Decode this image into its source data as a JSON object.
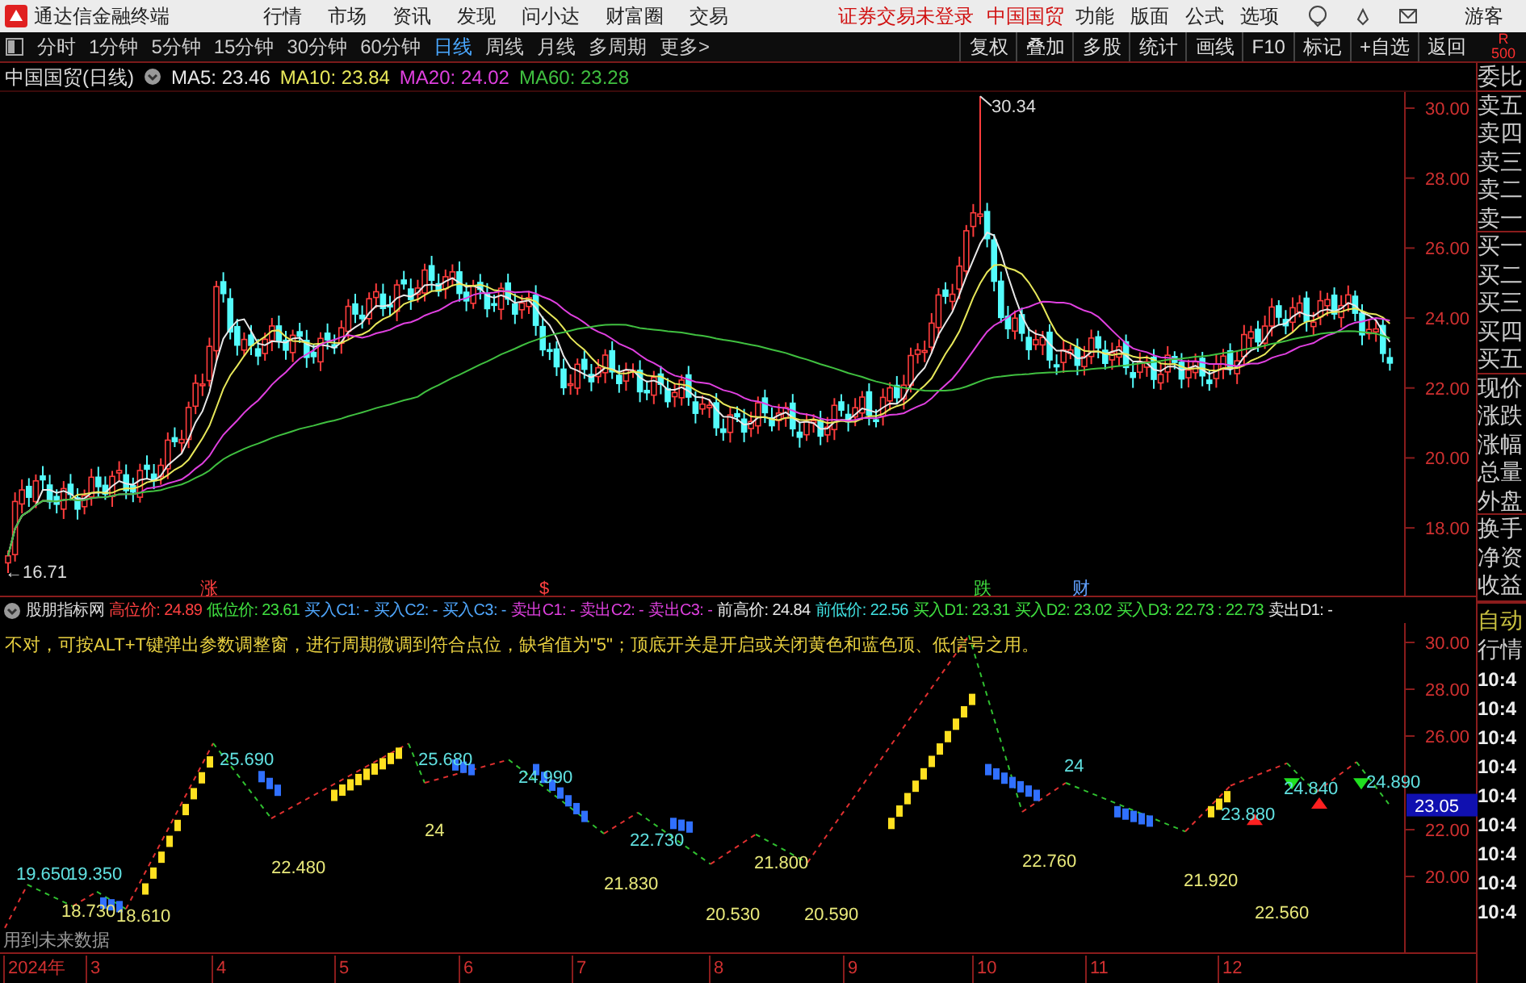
{
  "app": {
    "title": "通达信金融终端",
    "menu": [
      "行情",
      "市场",
      "资讯",
      "发现",
      "问小达",
      "财富圈",
      "交易"
    ],
    "notice": "证券交易未登录",
    "stock": "中国国贸",
    "right_menu": [
      "功能",
      "版面",
      "公式",
      "选项"
    ],
    "user": "游客"
  },
  "periods": [
    {
      "label": "分时",
      "selected": false
    },
    {
      "label": "1分钟",
      "selected": false
    },
    {
      "label": "5分钟",
      "selected": false
    },
    {
      "label": "15分钟",
      "selected": false
    },
    {
      "label": "30分钟",
      "selected": false
    },
    {
      "label": "60分钟",
      "selected": false
    },
    {
      "label": "日线",
      "selected": true
    },
    {
      "label": "周线",
      "selected": false
    },
    {
      "label": "月线",
      "selected": false
    },
    {
      "label": "多周期",
      "selected": false
    },
    {
      "label": "更多>",
      "selected": false
    }
  ],
  "tools": [
    "复权",
    "叠加",
    "多股",
    "统计",
    "画线",
    "F10",
    "标记",
    "+自选",
    "返回"
  ],
  "corner": [
    "R",
    "500"
  ],
  "main_chart": {
    "title": "中国国贸(日线)",
    "legend": [
      {
        "text": "MA5: 23.46",
        "color": "#e8e8e8"
      },
      {
        "text": "MA10: 23.84",
        "color": "#e8e85a"
      },
      {
        "text": "MA20: 24.02",
        "color": "#e040e0"
      },
      {
        "text": "MA60: 23.28",
        "color": "#40c040"
      }
    ],
    "high_label": "30.34",
    "low_label": "←16.71",
    "markers": [
      {
        "text": "涨",
        "color": "#ff4040"
      },
      {
        "text": "$",
        "color": "#ff4040"
      },
      {
        "text": "跌",
        "color": "#40e040"
      },
      {
        "text": "财",
        "color": "#60a0ff"
      }
    ],
    "price_axis": [
      "30.00",
      "28.00",
      "26.00",
      "24.00",
      "22.00",
      "20.00",
      "18.00"
    ]
  },
  "indicator": {
    "name": "股朋指标网",
    "legend": [
      {
        "text": "高位价: 24.89",
        "color": "#ff4040"
      },
      {
        "text": "低位价: 23.61",
        "color": "#40e040"
      },
      {
        "text": "买入C1: -",
        "color": "#50a8ff"
      },
      {
        "text": "买入C2: -",
        "color": "#50a8ff"
      },
      {
        "text": "买入C3: -",
        "color": "#50a8ff"
      },
      {
        "text": "卖出C1: -",
        "color": "#e040e0"
      },
      {
        "text": "卖出C2: -",
        "color": "#e040e0"
      },
      {
        "text": "卖出C3: -",
        "color": "#e040e0"
      },
      {
        "text": "前高价: 24.84",
        "color": "#e8e8e8"
      },
      {
        "text": "前低价: 22.56",
        "color": "#40e0e0"
      },
      {
        "text": "买入D1: 23.31",
        "color": "#40e040"
      },
      {
        "text": "买入D2: 23.02",
        "color": "#40e040"
      },
      {
        "text": "买入D3: 22.73 : 22.73",
        "color": "#40e040"
      },
      {
        "text": "卖出D1: -",
        "color": "#e8e8e8"
      }
    ],
    "info": "不对，可按ALT+T键弹出参数调整窗，进行周期微调到符合点位，缺省值为\"5\"；顶底开关是开启或关闭黄色和蓝色顶、低信号之用。",
    "labels": [
      {
        "text": "19.650",
        "kind": "high"
      },
      {
        "text": "18.730",
        "kind": "low"
      },
      {
        "text": "19.350",
        "kind": "high"
      },
      {
        "text": "18.610",
        "kind": "low"
      },
      {
        "text": "25.690",
        "kind": "high"
      },
      {
        "text": "22.480",
        "kind": "low"
      },
      {
        "text": "25.680",
        "kind": "high"
      },
      {
        "text": "24",
        "kind": "low"
      },
      {
        "text": "24.990",
        "kind": "high"
      },
      {
        "text": "21.830",
        "kind": "low"
      },
      {
        "text": "22.730",
        "kind": "high"
      },
      {
        "text": "20.530",
        "kind": "low"
      },
      {
        "text": "21.800",
        "kind": "low"
      },
      {
        "text": "20.590",
        "kind": "low"
      },
      {
        "text": "22.760",
        "kind": "low"
      },
      {
        "text": "24",
        "kind": "high"
      },
      {
        "text": "21.920",
        "kind": "low"
      },
      {
        "text": "23.880",
        "kind": "high"
      },
      {
        "text": "22.560",
        "kind": "low"
      },
      {
        "text": "24.840",
        "kind": "high"
      },
      {
        "text": "24.890",
        "kind": "high"
      }
    ],
    "note": "用到未来数据",
    "price_axis": [
      "30.00",
      "28.00",
      "26.00",
      "22.00",
      "20.00"
    ],
    "current_price": "23.05"
  },
  "x_axis": [
    "2024年",
    "3",
    "4",
    "5",
    "6",
    "7",
    "8",
    "9",
    "10",
    "11",
    "12"
  ],
  "side_panel": {
    "fields": [
      "委比",
      "卖五",
      "卖四",
      "卖三",
      "卖二",
      "卖一",
      "买一",
      "买二",
      "买三",
      "买四",
      "买五",
      "现价",
      "涨跌",
      "涨幅",
      "总量",
      "外盘",
      "换手",
      "净资",
      "收益"
    ],
    "mode": [
      "自动",
      "行情"
    ],
    "times": [
      "10:4",
      "10:4",
      "10:4",
      "10:4",
      "10:4",
      "10:4",
      "10:4",
      "10:4",
      "10:4"
    ]
  }
}
